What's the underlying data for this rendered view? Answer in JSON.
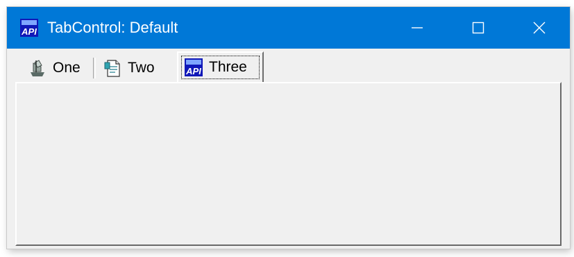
{
  "window": {
    "title": "TabControl: Default",
    "titlebar_color": "#0078d7",
    "app_icon": "api-app-icon",
    "caption_buttons": [
      "minimize",
      "maximize",
      "close"
    ]
  },
  "tabs": [
    {
      "label": "One",
      "icon": "ship-icon",
      "selected": false
    },
    {
      "label": "Two",
      "icon": "document-icon",
      "selected": false
    },
    {
      "label": "Three",
      "icon": "api-icon",
      "selected": true
    }
  ],
  "app_icon_text": "API"
}
